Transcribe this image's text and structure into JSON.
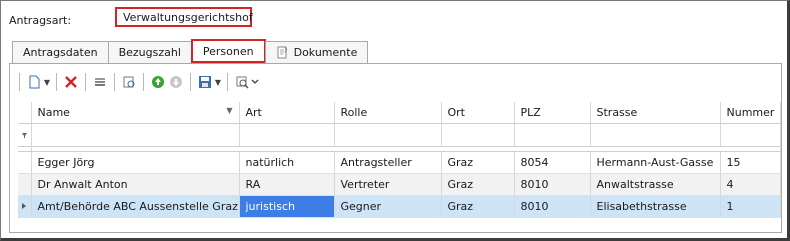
{
  "header": {
    "antragsart_label": "Antragsart:",
    "antragsart_value": "Verwaltungsgerichtshof"
  },
  "tabs": [
    {
      "label": "Antragsdaten"
    },
    {
      "label": "Bezugszahl"
    },
    {
      "label": "Personen"
    },
    {
      "label": "Dokumente"
    }
  ],
  "grid": {
    "columns": [
      "Name",
      "Art",
      "Rolle",
      "Ort",
      "PLZ",
      "Strasse",
      "Nummer"
    ],
    "rows": [
      [
        "Egger Jörg",
        "natürlich",
        "Antragsteller",
        "Graz",
        "8054",
        "Hermann-Aust-Gasse",
        "15"
      ],
      [
        "Dr Anwalt Anton",
        "RA",
        "Vertreter",
        "Graz",
        "8010",
        "Anwaltstrasse",
        "4"
      ],
      [
        "Amt/Behörde ABC Aussenstelle Graz",
        "juristisch",
        "Gegner",
        "Graz",
        "8010",
        "Elisabethstrasse",
        "1"
      ]
    ]
  },
  "colors": {
    "highlight": "#d42323",
    "selected_cell": "#3d7ee6",
    "selected_row": "#cde4f7"
  }
}
